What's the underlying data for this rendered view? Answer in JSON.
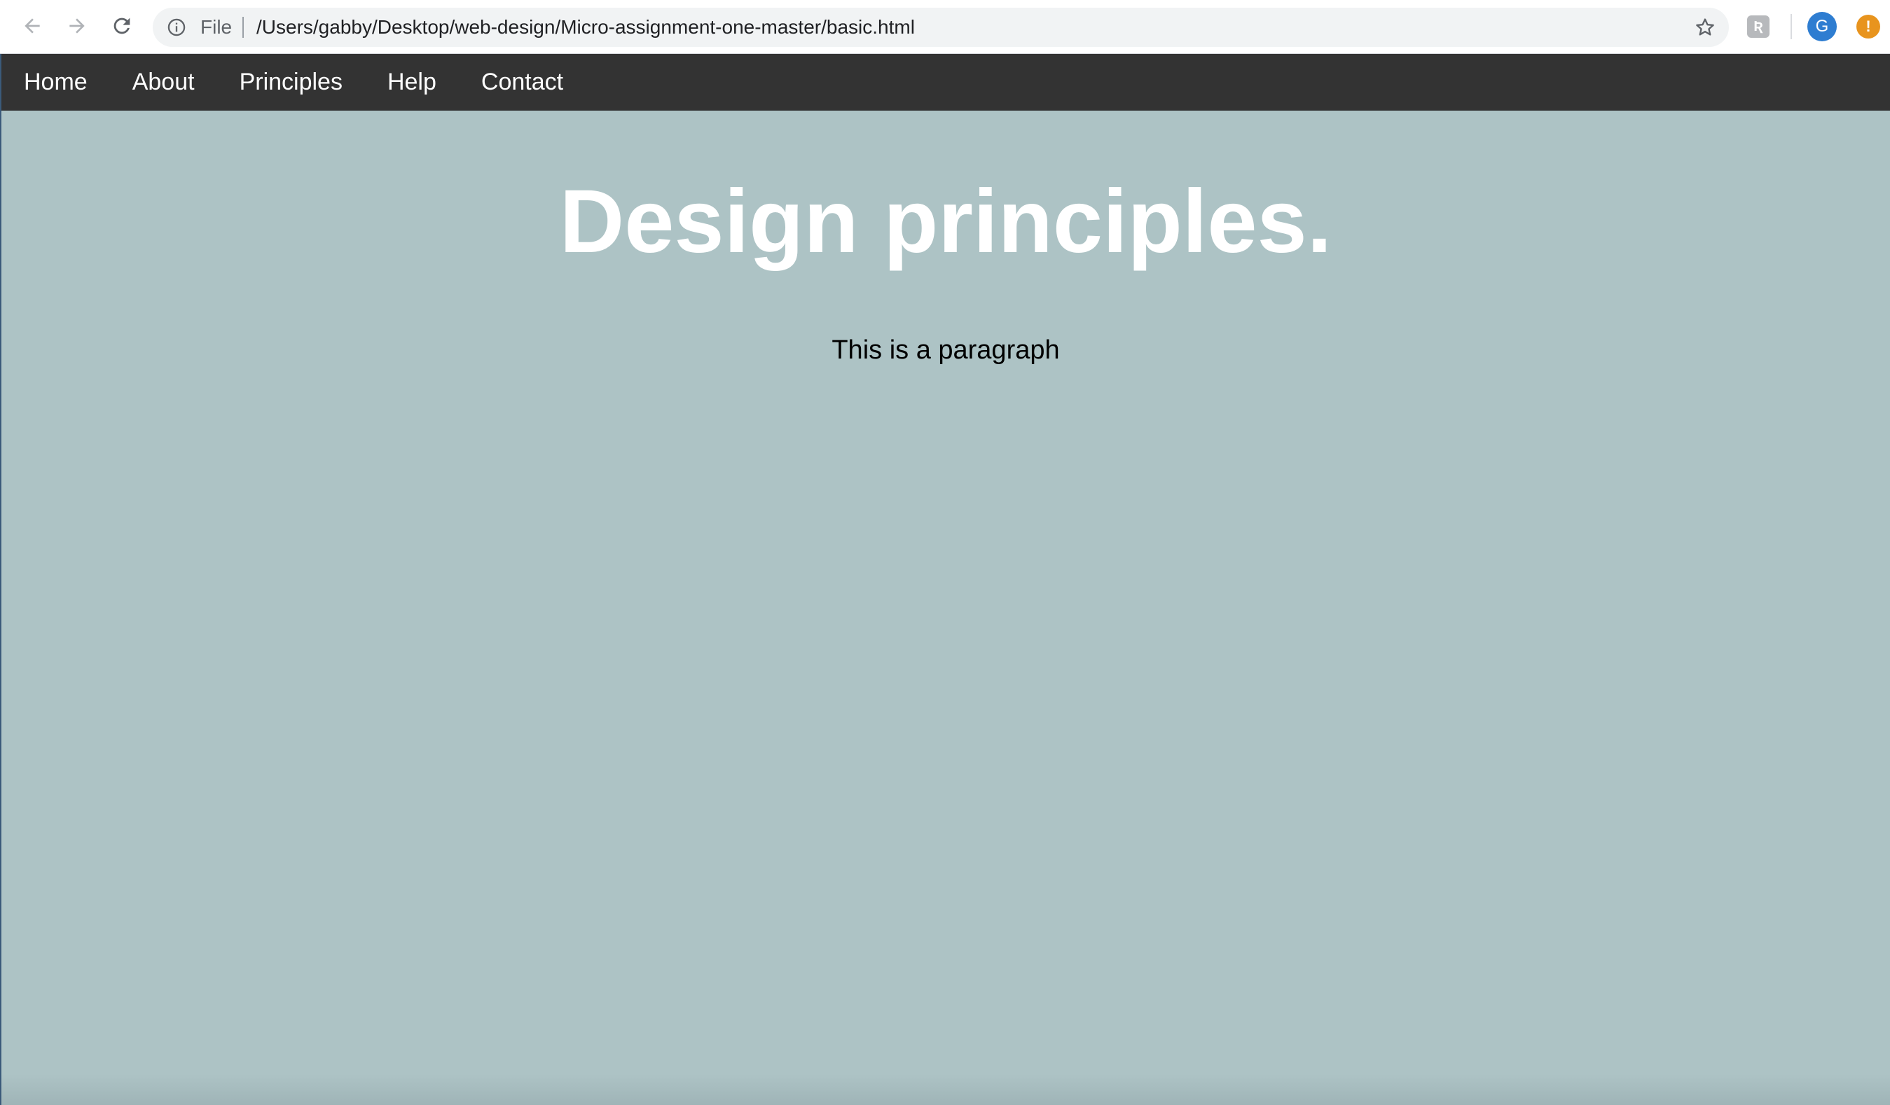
{
  "browser": {
    "omnibox": {
      "scheme_label": "File",
      "url": "/Users/gabby/Desktop/web-design/Micro-assignment-one-master/basic.html"
    },
    "extension_icon_glyph": "Ʀ",
    "profile_initial": "G",
    "alert_glyph": "!",
    "icons": [
      "back-arrow-icon",
      "forward-arrow-icon",
      "reload-icon",
      "info-icon",
      "star-icon",
      "extension-icon",
      "profile-avatar",
      "alert-icon"
    ]
  },
  "site": {
    "nav": {
      "items": [
        {
          "label": "Home"
        },
        {
          "label": "About"
        },
        {
          "label": "Principles"
        },
        {
          "label": "Help"
        },
        {
          "label": "Contact"
        }
      ]
    },
    "title": "Design principles.",
    "paragraph": "This is a paragraph"
  },
  "colors": {
    "page_background": "#adc3c5",
    "nav_background": "#333333",
    "title_color": "#ffffff",
    "avatar": "#2e7dd1",
    "alert": "#e8941e"
  }
}
